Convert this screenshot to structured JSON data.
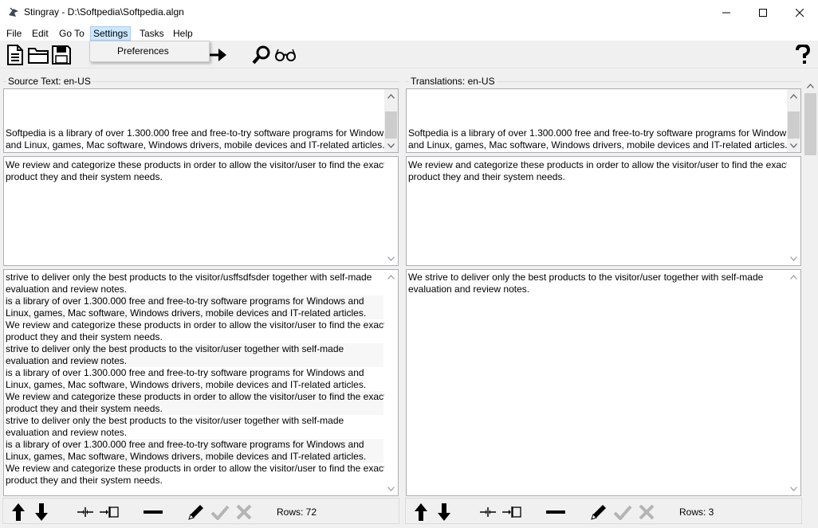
{
  "window": {
    "title": "Stingray - D:\\Softpedia\\Softpedia.algn"
  },
  "menu": {
    "file": "File",
    "edit": "Edit",
    "goto": "Go To",
    "settings": "Settings",
    "tasks": "Tasks",
    "help": "Help"
  },
  "dropdown": {
    "preferences": "Preferences"
  },
  "source": {
    "label": "Source Text: en-US",
    "preview_lines": [
      "",
      "",
      "",
      "Softpedia is a library of over 1.300.000 free and free-to-try software programs for Windows",
      "and Linux, games, Mac software, Windows drivers, mobile devices and IT-related articles."
    ],
    "editor_lines": [
      "We review and categorize these products in order to allow the visitor/user to find the exact",
      "product they and their system needs."
    ],
    "list_lines": [
      "strive to deliver only the best products to the visitor/usffsdfsder together with self-made",
      "evaluation and review notes.",
      "is a library of over 1.300.000 free and free-to-try software programs for Windows and",
      "Linux, games, Mac software, Windows drivers, mobile devices and IT-related articles.",
      "We review and categorize these products in order to allow the visitor/user to find the exact",
      "product they and their system needs.",
      "strive to deliver only the best products to the visitor/user together with self-made",
      "evaluation and review notes.",
      "is a library of over 1.300.000 free and free-to-try software programs for Windows and",
      "Linux, games, Mac software, Windows drivers, mobile devices and IT-related articles.",
      "We review and categorize these products in order to allow the visitor/user to find the exact",
      "product they and their system needs.",
      "strive to deliver only the best products to the visitor/user together with self-made",
      "evaluation and review notes.",
      "is a library of over 1.300.000 free and free-to-try software programs for Windows and",
      "Linux, games, Mac software, Windows drivers, mobile devices and IT-related articles.",
      "We review and categorize these products in order to allow the visitor/user to find the exact",
      "product they and their system needs."
    ],
    "rows": "Rows: 72"
  },
  "translation": {
    "label": "Translations: en-US",
    "preview_lines": [
      "",
      "",
      "",
      "Softpedia is a library of over 1.300.000 free and free-to-try software programs for Windows",
      "and Linux, games, Mac software, Windows drivers, mobile devices and IT-related articles."
    ],
    "editor_lines": [
      "We review and categorize these products in order to allow the visitor/user to find the exact",
      "product they and their system needs."
    ],
    "list_lines": [
      "We strive to deliver only the best products to the visitor/user together with self-made",
      "evaluation and review notes."
    ],
    "rows": "Rows: 3"
  },
  "colors": {
    "menu_highlight": "#cce8ff",
    "disabled_icon": "#b4b4b4"
  }
}
